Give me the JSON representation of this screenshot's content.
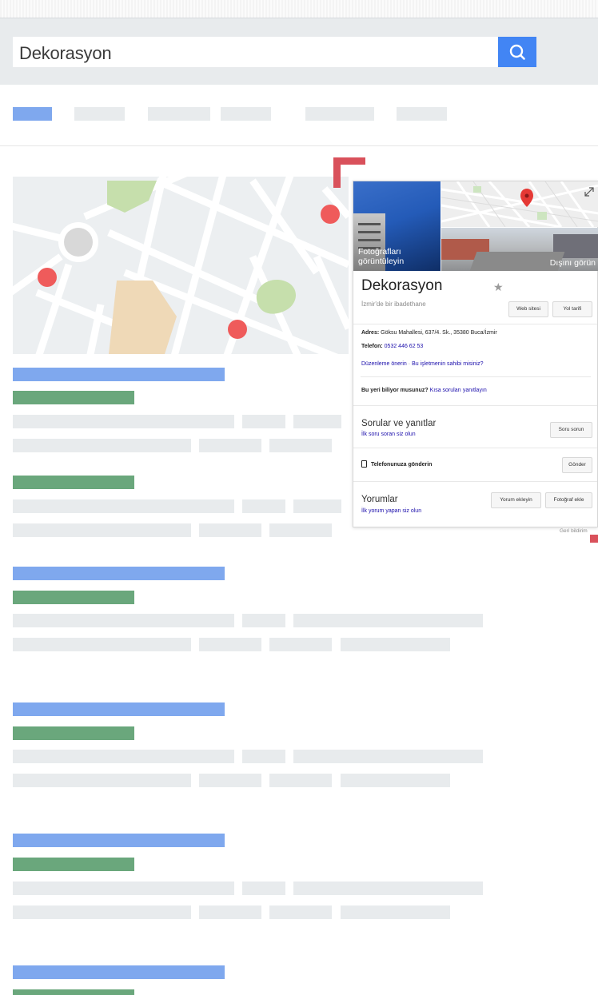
{
  "search": {
    "query": "Dekorasyon"
  },
  "panel": {
    "photo_caption": "Fotoğrafları görüntüleyin",
    "street_caption": "Dışını görün",
    "title": "Dekorasyon",
    "subtitle": "İzmir'de bir ibadethane",
    "website_button": "Web sitesi",
    "directions_button": "Yol tarifi",
    "address_label": "Adres:",
    "address_value": "Göksu Mahallesi, 637/4. Sk., 35380 Buca/İzmir",
    "phone_label": "Telefon:",
    "phone_value": "0532 446 62 53",
    "suggest_edit": "Düzenleme önerin",
    "separator": "·",
    "own_business": "Bu işletmenin sahibi misiniz?",
    "know_place_question": "Bu yeri biliyor musunuz?",
    "know_place_link": "Kısa soruları yanıtlayın",
    "qa_title": "Sorular ve yanıtlar",
    "qa_link": "İlk soru soran siz olun",
    "ask_button": "Soru sorun",
    "send_phone": "Telefonunuza gönderin",
    "send_button": "Gönder",
    "reviews_title": "Yorumlar",
    "reviews_link": "İlk yorum yapan siz olun",
    "add_review_button": "Yorum ekleyin",
    "add_photo_button": "Fotoğraf ekle",
    "feedback": "Geri bildirim"
  },
  "colors": {
    "search_button": "#4285f4",
    "placeholder_gray": "#e8ebed",
    "placeholder_blue": "#7fa8ee",
    "placeholder_green": "#6aa77c",
    "map_pin": "#ef5b5b",
    "highlight_corner": "#d9515b"
  },
  "icons": [
    "search-icon",
    "star-icon",
    "phone-send-icon",
    "map-pin-icon",
    "expand-icon"
  ]
}
